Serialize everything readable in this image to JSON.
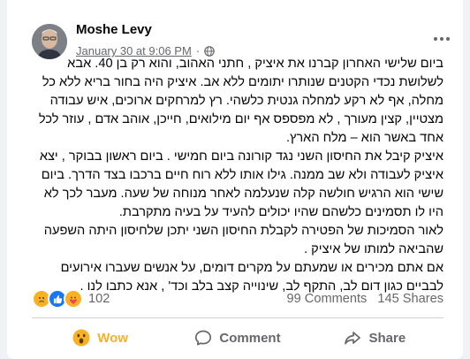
{
  "post": {
    "author": "Moshe Levy",
    "date": "January 30 at 9:06 PM",
    "separator": "·",
    "paragraphs": [
      "ביום שלישי האחרון קברנו את איציק , חתני האהוב, והוא רק בן 40. אבא לשלושת נכדי הקטנים שנותרו יתומים ללא אב. איציק היה בחור בריא ללא כל מחלה, אף לא רקע למחלה גנטית כלשהי. רץ למרחקים ארוכים, איש עבודה מצטיין, קצין מעורך , לא מפספס אף יום מילואים, חייכן, אוהב אדם , עוזר לכל אחד באשר הוא – מלח הארץ.",
      "איציק קיבל את החיסון השני נגד קורונה ביום חמישי . ביום ראשון בבוקר , יצא איציק לעבודה ולא שב ממנה. גילו אותו ללא רוח חיים ברכבו בצד הדרך. ביום שישי הוא הרגיש חולשה קלה שנעלמה לאחר מנוחה של שעה. מעבר לכך לא היו לו תסמינים כלשהם שהיו יכולים להעיד על בעיה מתקרבת.",
      "לאור הסמיכות של הפטירה לקבלת החיסון השני יתכן שלחיסון היתה השפעה שהביאה למותו של איציק .",
      "אם אתם מכירים או שמעתם על מקרים דומים, על אנשים שעברו אירועים לבביים כגון דום לב, התקף לב, שינוייה קצב בלב וכד' , אנא כתבו לנו ."
    ]
  },
  "stats": {
    "reaction_count": "102",
    "comments": "99 Comments",
    "shares": "145 Shares",
    "reaction_icons": [
      "sad-icon",
      "like-icon",
      "care-icon"
    ]
  },
  "actions": {
    "wow_label": "Wow",
    "comment_label": "Comment",
    "share_label": "Share"
  },
  "colors": {
    "wow": "#f7b125",
    "like": "#1877f2",
    "text": "#050505",
    "muted": "#65676b"
  }
}
